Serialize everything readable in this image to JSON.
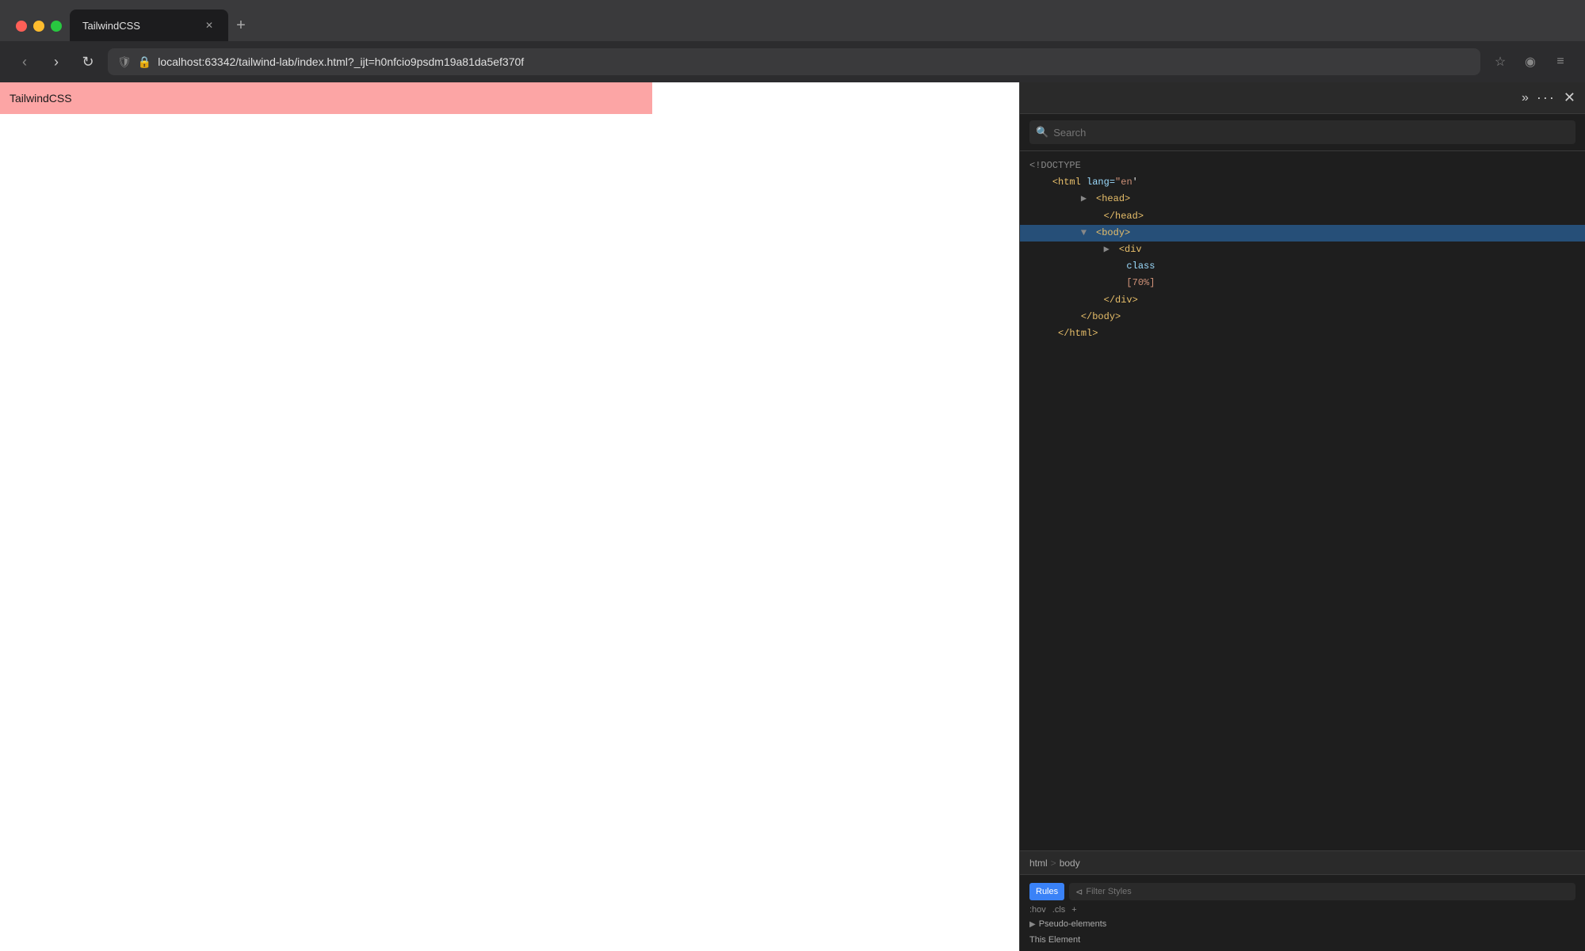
{
  "browser": {
    "tab_title": "TailwindCSS",
    "url": "localhost:63342/tailwind-lab/index.html?_ijt=h0nfcio9psdm19a81da5ef370f",
    "page_title": "TailwindCSS"
  },
  "devtools": {
    "search_placeholder": "Search",
    "html_lines": [
      {
        "indent": 0,
        "content": "<!DOCTYPE",
        "type": "doctype"
      },
      {
        "indent": 0,
        "content": "<html",
        "attr": "lang",
        "val": "\"en\"",
        "type": "open"
      },
      {
        "indent": 1,
        "content": "<head>",
        "type": "collapsed"
      },
      {
        "indent": 1,
        "content": "</head>",
        "type": "close"
      },
      {
        "indent": 1,
        "content": "<body>",
        "type": "selected"
      },
      {
        "indent": 2,
        "content": "<div",
        "type": "collapsed"
      },
      {
        "indent": 3,
        "content": "class",
        "type": "attr-line"
      },
      {
        "indent": 3,
        "content": "[70%]",
        "type": "attr-val"
      },
      {
        "indent": 2,
        "content": "</div>",
        "type": "close-inner"
      },
      {
        "indent": 1,
        "content": "</body>",
        "type": "close"
      },
      {
        "indent": 0,
        "content": "</html>",
        "type": "close"
      }
    ],
    "breadcrumb": [
      "html",
      "body"
    ],
    "rules_label": "Rules",
    "filter_styles_placeholder": "Filter Styles",
    "pseudo_states": [
      ":hov",
      ".cls"
    ],
    "pseudo_elements_label": "Pseudo-elements",
    "this_element_label": "This Element"
  }
}
